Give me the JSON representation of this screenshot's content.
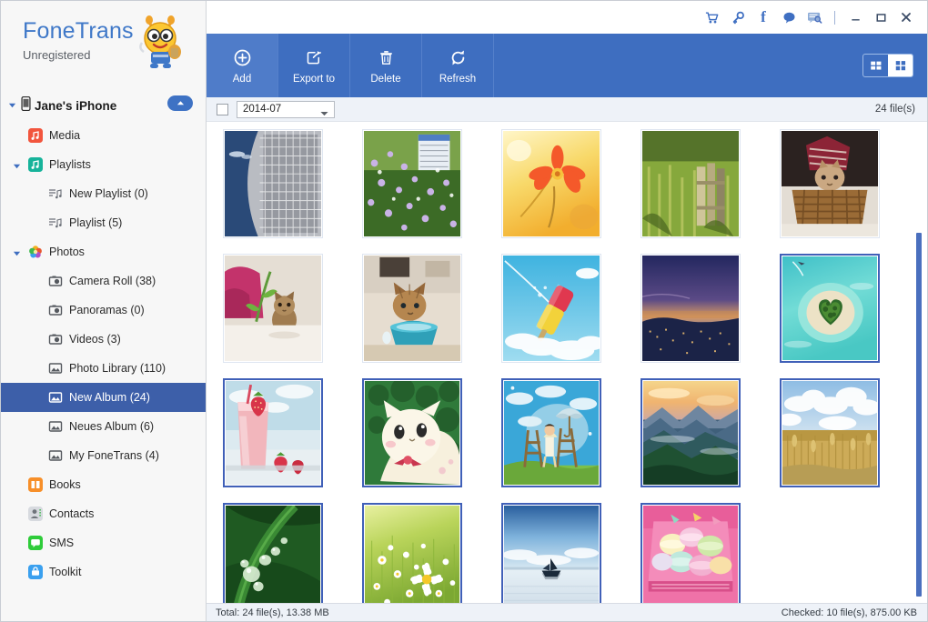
{
  "app": {
    "brand_title": "FoneTrans",
    "brand_subtitle": "Unregistered",
    "mascot_icon": "bee-mascot-icon"
  },
  "titlebar": {
    "icons": [
      {
        "name": "cart-icon",
        "glyph": "🛒"
      },
      {
        "name": "key-icon",
        "glyph": "🔑"
      },
      {
        "name": "facebook-icon",
        "glyph": "f"
      },
      {
        "name": "chat-icon",
        "glyph": "💬"
      },
      {
        "name": "feedback-icon",
        "glyph": "🗪"
      }
    ],
    "minimize_label": "–",
    "maximize_label": "□",
    "close_label": "✕"
  },
  "sidebar": {
    "device": {
      "label": "Jane's iPhone",
      "icon": "iphone-icon",
      "eject_icon": "eject-icon"
    },
    "items": [
      {
        "label": "Media",
        "icon": "media-icon",
        "level": 1,
        "caret": false,
        "selected": false,
        "color": "#f2553d"
      },
      {
        "label": "Playlists",
        "icon": "playlists-icon",
        "level": 1,
        "caret": true,
        "selected": false,
        "color": "#16b39a"
      },
      {
        "label": "New Playlist (0)",
        "icon": "playlist-item-icon",
        "level": 2,
        "caret": false,
        "selected": false,
        "color": "#6b7078"
      },
      {
        "label": "Playlist (5)",
        "icon": "playlist-item-icon",
        "level": 2,
        "caret": false,
        "selected": false,
        "color": "#6b7078"
      },
      {
        "label": "Photos",
        "icon": "photos-icon",
        "level": 1,
        "caret": true,
        "selected": false,
        "color": "#e8572f"
      },
      {
        "label": "Camera Roll (38)",
        "icon": "camera-icon",
        "level": 2,
        "caret": false,
        "selected": false,
        "color": "#55595f"
      },
      {
        "label": "Panoramas (0)",
        "icon": "camera-icon",
        "level": 2,
        "caret": false,
        "selected": false,
        "color": "#55595f"
      },
      {
        "label": "Videos (3)",
        "icon": "camera-icon",
        "level": 2,
        "caret": false,
        "selected": false,
        "color": "#55595f"
      },
      {
        "label": "Photo Library (110)",
        "icon": "album-icon",
        "level": 2,
        "caret": false,
        "selected": false,
        "color": "#55595f"
      },
      {
        "label": "New Album (24)",
        "icon": "album-icon",
        "level": 2,
        "caret": false,
        "selected": true,
        "color": "#ffffff"
      },
      {
        "label": "Neues Album (6)",
        "icon": "album-icon",
        "level": 2,
        "caret": false,
        "selected": false,
        "color": "#55595f"
      },
      {
        "label": "My FoneTrans (4)",
        "icon": "album-icon",
        "level": 2,
        "caret": false,
        "selected": false,
        "color": "#55595f"
      },
      {
        "label": "Books",
        "icon": "books-icon",
        "level": 1,
        "caret": false,
        "selected": false,
        "color": "#f78f29"
      },
      {
        "label": "Contacts",
        "icon": "contacts-icon",
        "level": 1,
        "caret": false,
        "selected": false,
        "color": "#9aa0a8"
      },
      {
        "label": "SMS",
        "icon": "sms-icon",
        "level": 1,
        "caret": false,
        "selected": false,
        "color": "#2fcc3a"
      },
      {
        "label": "Toolkit",
        "icon": "toolkit-icon",
        "level": 1,
        "caret": false,
        "selected": false,
        "color": "#3aa0ef"
      }
    ]
  },
  "toolbar": {
    "buttons": [
      {
        "label": "Add",
        "icon": "add-icon",
        "active": true
      },
      {
        "label": "Export to",
        "icon": "export-icon",
        "active": false
      },
      {
        "label": "Delete",
        "icon": "trash-icon",
        "active": false
      },
      {
        "label": "Refresh",
        "icon": "refresh-icon",
        "active": false
      }
    ],
    "view_modes": [
      {
        "name": "list-view-icon",
        "active": false
      },
      {
        "name": "grid-view-icon",
        "active": true
      }
    ]
  },
  "filterbar": {
    "select_all_checkbox": "select-all-checkbox",
    "date_value": "2014-07",
    "date_caret_icon": "chevron-down-icon",
    "file_count": "24 file(s)"
  },
  "statusbar": {
    "total": "Total: 24 file(s), 13.38 MB",
    "checked": "Checked: 10 file(s), 875.00 KB"
  },
  "colors": {
    "accent_blue": "#3e6ec0",
    "selection_blue": "#3d5fa9",
    "thumb_border_selected": "#4060b8",
    "brand_blue": "#3f78c8"
  },
  "grid": {
    "thumbnails": [
      {
        "name": "sky-mesh-building",
        "selected": false,
        "c1": "#2a4a78",
        "c2": "#c9ccd1",
        "c3": "#8f939a",
        "kind": "split"
      },
      {
        "name": "purple-wildflowers",
        "selected": false,
        "c1": "#b8a8d8",
        "c2": "#5d8a3a",
        "c3": "#3c6b26",
        "kind": "garden"
      },
      {
        "name": "orange-cosmos-flower",
        "selected": false,
        "c1": "#ffe37a",
        "c2": "#f4592a",
        "c3": "#f6c244",
        "kind": "flower"
      },
      {
        "name": "grass-fence",
        "selected": false,
        "c1": "#7d9b3a",
        "c2": "#4f6a23",
        "c3": "#b5a36a",
        "kind": "garden"
      },
      {
        "name": "kitten-in-basket",
        "selected": false,
        "c1": "#2a2020",
        "c2": "#b07848",
        "c3": "#d8c3a5",
        "kind": "basket"
      },
      {
        "name": "kitten-by-pillow",
        "selected": false,
        "c1": "#efe9e2",
        "c2": "#c3336b",
        "c3": "#8a6a44",
        "kind": "pillow"
      },
      {
        "name": "kitten-drinking-bowl",
        "selected": false,
        "c1": "#e5ddd2",
        "c2": "#2fa0b8",
        "c3": "#9b7344",
        "kind": "bowl"
      },
      {
        "name": "ice-lolly-sky",
        "selected": false,
        "c1": "#4cc0e8",
        "c2": "#f2d23a",
        "c3": "#e0384f",
        "kind": "lolly"
      },
      {
        "name": "coastal-city-dusk",
        "selected": false,
        "c1": "#2b2f6e",
        "c2": "#6a4f86",
        "c3": "#d4a05a",
        "kind": "dusk"
      },
      {
        "name": "heart-shaped-island",
        "selected": true,
        "c1": "#5fd8d2",
        "c2": "#f0e7cf",
        "c3": "#3c6b26",
        "kind": "island"
      },
      {
        "name": "strawberry-milkshake",
        "selected": true,
        "c1": "#cfe6ee",
        "c2": "#f0b6b8",
        "c3": "#d8354a",
        "kind": "shake"
      },
      {
        "name": "white-cat-cartoon",
        "selected": true,
        "c1": "#2f7a3a",
        "c2": "#f7f0dd",
        "c3": "#c9364f",
        "kind": "cartoon"
      },
      {
        "name": "umbrella-illustration",
        "selected": true,
        "c1": "#3aa7d8",
        "c2": "#dfe9ee",
        "c3": "#6aa83a",
        "kind": "umbrella"
      },
      {
        "name": "misty-mountains",
        "selected": true,
        "c1": "#f3c879",
        "c2": "#3f5f7a",
        "c3": "#1f5132",
        "kind": "mountain"
      },
      {
        "name": "wheat-field-clouds",
        "selected": true,
        "c1": "#bdd6ee",
        "c2": "#d6bb72",
        "c3": "#b79d55",
        "kind": "wheat"
      },
      {
        "name": "dew-on-leaf",
        "selected": true,
        "c1": "#1f5a22",
        "c2": "#3d8f36",
        "c3": "#d8ecd2",
        "kind": "leaf"
      },
      {
        "name": "daisy-meadow",
        "selected": true,
        "c1": "#d9e86a",
        "c2": "#8cb63a",
        "c3": "#ffffff",
        "kind": "daisy"
      },
      {
        "name": "boat-on-salt-flat",
        "selected": true,
        "c1": "#2f6fae",
        "c2": "#dfeaf2",
        "c3": "#1b2a3a",
        "kind": "boat"
      },
      {
        "name": "pink-macarons",
        "selected": true,
        "c1": "#ef72a8",
        "c2": "#f7e7a8",
        "c3": "#8fd8c2",
        "kind": "macaron"
      }
    ]
  }
}
